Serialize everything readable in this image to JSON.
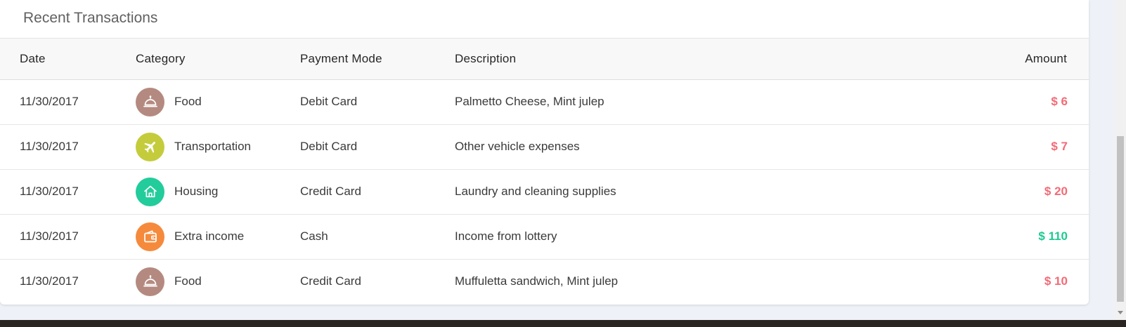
{
  "panel": {
    "title": "Recent Transactions"
  },
  "table": {
    "headers": {
      "date": "Date",
      "category": "Category",
      "payment_mode": "Payment Mode",
      "description": "Description",
      "amount": "Amount"
    },
    "rows": [
      {
        "date": "11/30/2017",
        "category": "Food",
        "icon": "cloche-icon",
        "icon_color": "#b48a80",
        "payment_mode": "Debit Card",
        "description": "Palmetto Cheese, Mint julep",
        "amount": "$ 6",
        "amount_type": "expense"
      },
      {
        "date": "11/30/2017",
        "category": "Transportation",
        "icon": "airplane-icon",
        "icon_color": "#c4cc3c",
        "payment_mode": "Debit Card",
        "description": "Other vehicle expenses",
        "amount": "$ 7",
        "amount_type": "expense"
      },
      {
        "date": "11/30/2017",
        "category": "Housing",
        "icon": "house-icon",
        "icon_color": "#23cc9b",
        "payment_mode": "Credit Card",
        "description": "Laundry and cleaning supplies",
        "amount": "$ 20",
        "amount_type": "expense"
      },
      {
        "date": "11/30/2017",
        "category": "Extra income",
        "icon": "wallet-icon",
        "icon_color": "#f58a3c",
        "payment_mode": "Cash",
        "description": "Income from lottery",
        "amount": "$ 110",
        "amount_type": "income"
      },
      {
        "date": "11/30/2017",
        "category": "Food",
        "icon": "cloche-icon",
        "icon_color": "#b48a80",
        "payment_mode": "Credit Card",
        "description": "Muffuletta sandwich, Mint julep",
        "amount": "$ 10",
        "amount_type": "expense"
      }
    ]
  },
  "colors": {
    "expense": "#f26b76",
    "income": "#1ec992"
  }
}
